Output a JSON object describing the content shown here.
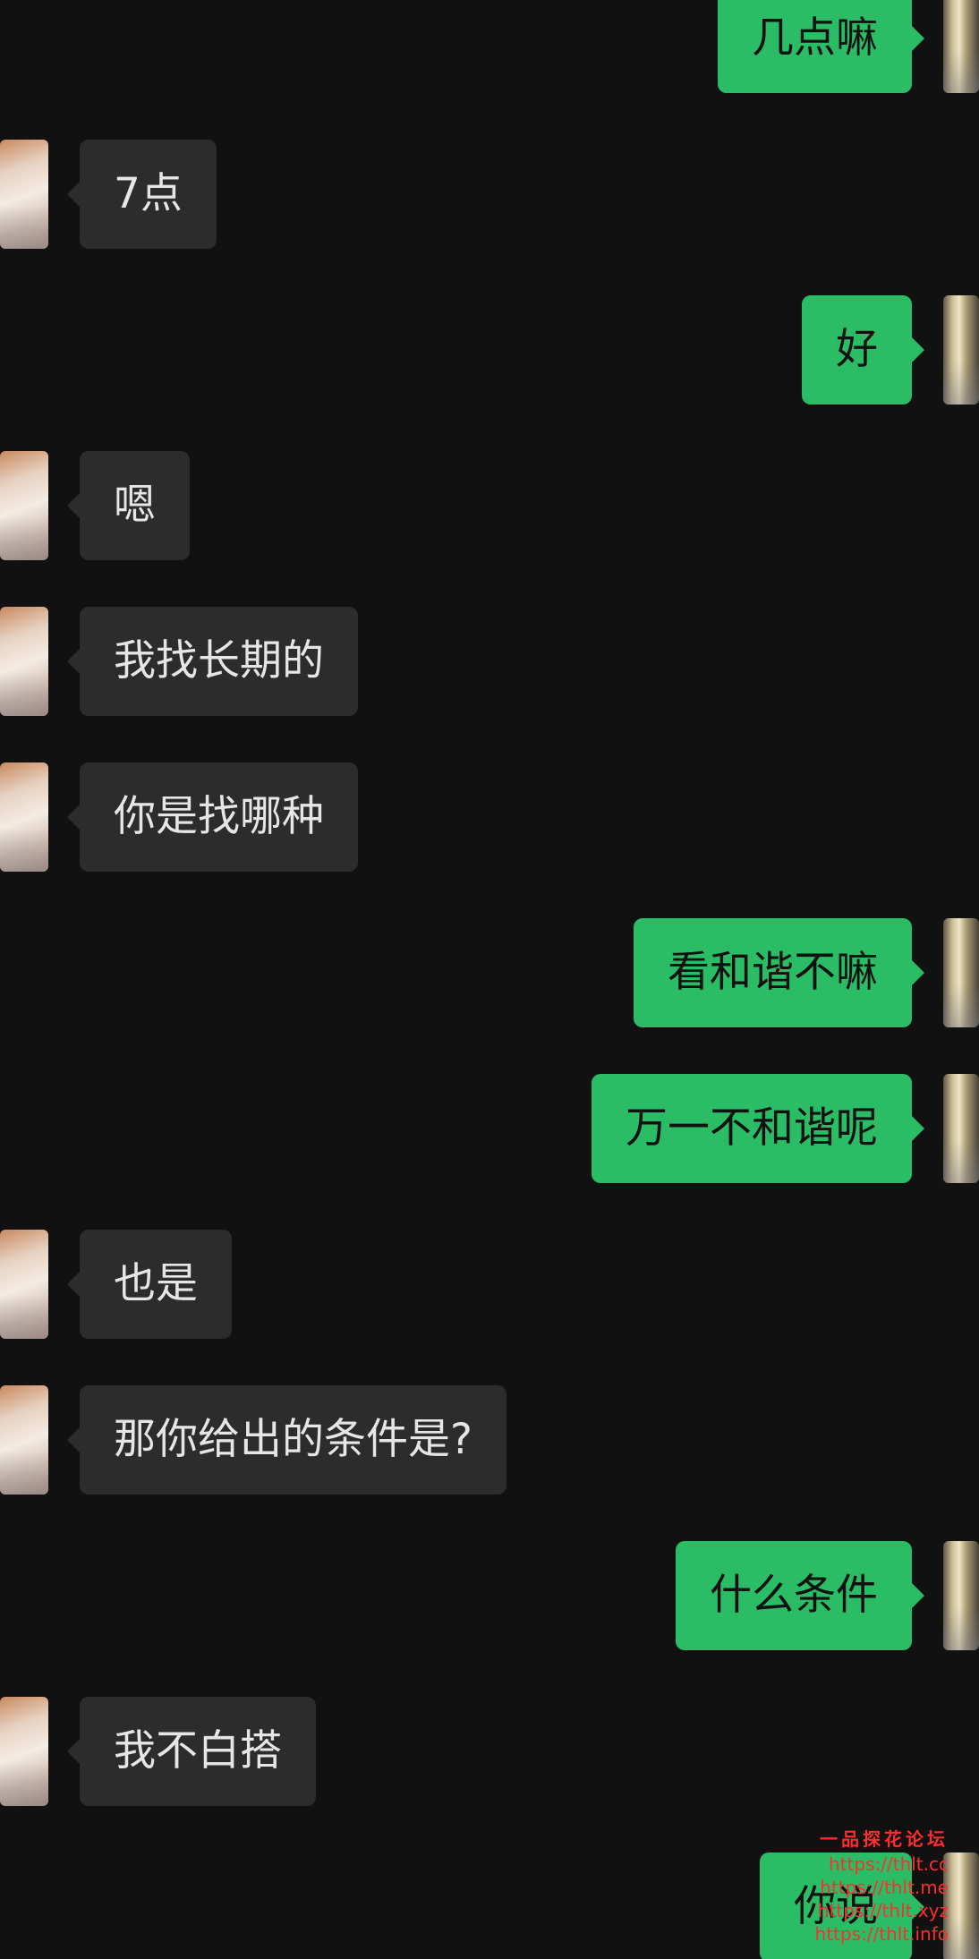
{
  "messages": [
    {
      "direction": "out",
      "text": "几点嘛"
    },
    {
      "direction": "in",
      "text": "7点"
    },
    {
      "direction": "out",
      "text": "好"
    },
    {
      "direction": "in",
      "text": "嗯"
    },
    {
      "direction": "in",
      "text": "我找长期的"
    },
    {
      "direction": "in",
      "text": "你是找哪种"
    },
    {
      "direction": "out",
      "text": "看和谐不嘛"
    },
    {
      "direction": "out",
      "text": "万一不和谐呢"
    },
    {
      "direction": "in",
      "text": "也是"
    },
    {
      "direction": "in",
      "text": "那你给出的条件是?"
    },
    {
      "direction": "out",
      "text": "什么条件"
    },
    {
      "direction": "in",
      "text": "我不白搭"
    },
    {
      "direction": "out",
      "text": "你说"
    }
  ],
  "watermark": {
    "title": "一品探花论坛",
    "links": [
      "https://thlt.cc",
      "https://thlt.me",
      "https://thlt.xyz",
      "https://thlt.info"
    ]
  },
  "colors": {
    "background": "#111111",
    "incoming_bubble": "#2c2c2c",
    "outgoing_bubble": "#2bbd66",
    "watermark": "#ff2d2d"
  }
}
